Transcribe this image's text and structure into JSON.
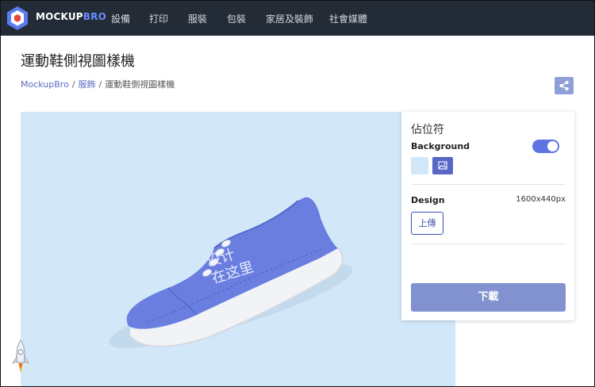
{
  "brand": {
    "name_part1": "MOCKUP",
    "name_part2": "BRO"
  },
  "nav": {
    "items": [
      "設備",
      "打印",
      "服裝",
      "包裝",
      "家居及裝飾",
      "社會媒體"
    ]
  },
  "page": {
    "title": "運動鞋側視圖樣機"
  },
  "breadcrumb": {
    "home": "MockupBro",
    "category": "服飾",
    "current": "運動鞋側視圖樣機"
  },
  "canvas": {
    "background_color": "#d2e7f8",
    "shoe_color": "#6a7ee0",
    "placeholder_text": [
      "设计",
      "在这里"
    ]
  },
  "panel": {
    "title": "佔位符",
    "background_label": "Background",
    "background_enabled": true,
    "background_color": "#d2e7f8",
    "design_label": "Design",
    "design_size": "1600x440px",
    "upload_label": "上傳",
    "download_label": "下載"
  },
  "colors": {
    "navbar": "#232b37",
    "accent": "#5f74e2",
    "link": "#5c6bc0",
    "download": "#8292d1"
  }
}
